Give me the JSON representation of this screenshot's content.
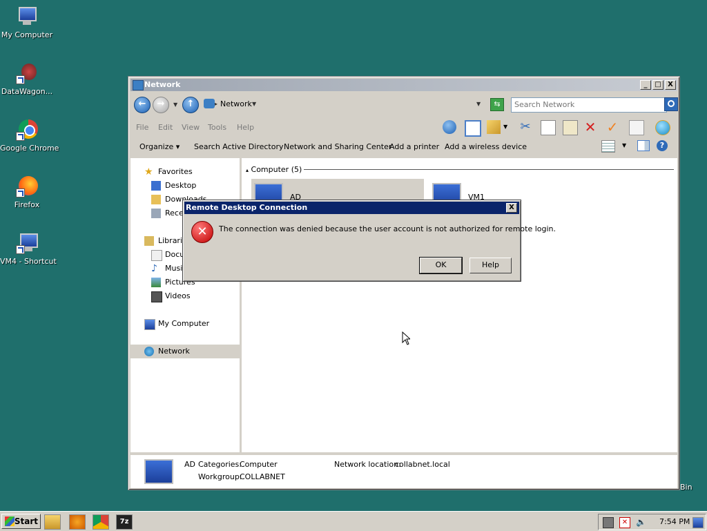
{
  "desktop": {
    "icons": [
      {
        "label": "My Computer",
        "icon": "computer-icon"
      },
      {
        "label": "DataWagon...",
        "icon": "datawagon-icon"
      },
      {
        "label": "Google Chrome",
        "icon": "chrome-icon"
      },
      {
        "label": "Firefox",
        "icon": "firefox-icon"
      },
      {
        "label": "VM4 - Shortcut",
        "icon": "remote-desktop-icon"
      }
    ],
    "recycle_bin_label": "Bin"
  },
  "explorer": {
    "title": "Network",
    "window_controls": {
      "minimize": "_",
      "maximize": "□",
      "close": "X"
    },
    "address": {
      "crumb": "Network",
      "separator": "▸"
    },
    "search_placeholder": "Search Network",
    "menu": [
      "File",
      "Edit",
      "View",
      "Tools",
      "Help"
    ],
    "commands": [
      "Organize",
      "Search Active Directory",
      "Network and Sharing Center",
      "Add a printer",
      "Add a wireless device"
    ],
    "organize_arrow": "▾",
    "nav_pane": {
      "favorites": {
        "label": "Favorites",
        "items": [
          "Desktop",
          "Downloads",
          "Recent Places"
        ]
      },
      "libraries": {
        "label": "Libraries",
        "items": [
          "Documents",
          "Music",
          "Pictures",
          "Videos"
        ]
      },
      "my_computer": "My Computer",
      "network": "Network"
    },
    "group": {
      "header": "Computer (5)",
      "collapse_glyph": "▴"
    },
    "items": [
      {
        "name": "AD",
        "selected": true
      },
      {
        "name": "VM1",
        "selected": false
      }
    ],
    "details": {
      "name": "AD",
      "categories_label": "Categories:",
      "categories_value": "Computer",
      "workgroup_label": "Workgroup:",
      "workgroup_value": "COLLABNET",
      "network_location_label": "Network location:",
      "network_location_value": "collabnet.local"
    }
  },
  "dialog": {
    "title": "Remote Desktop Connection",
    "close": "X",
    "icon": "error-icon",
    "message": "The connection was denied because the user account is not authorized for remote login.",
    "ok_label": "OK",
    "help_label": "Help"
  },
  "taskbar": {
    "start_label": "Start",
    "quick_launch": [
      "explorer-icon",
      "media-player-icon",
      "chrome-icon",
      "7zip-icon"
    ],
    "quick_launch_7zip_text": "7z",
    "clock": "7:54 PM",
    "tray_icons": [
      "network-icon",
      "security-icon",
      "volume-icon",
      "display-icon"
    ]
  },
  "colors": {
    "desktop": "#1f6f6c",
    "dialog_title": "#0a246a",
    "error": "#c00000"
  }
}
